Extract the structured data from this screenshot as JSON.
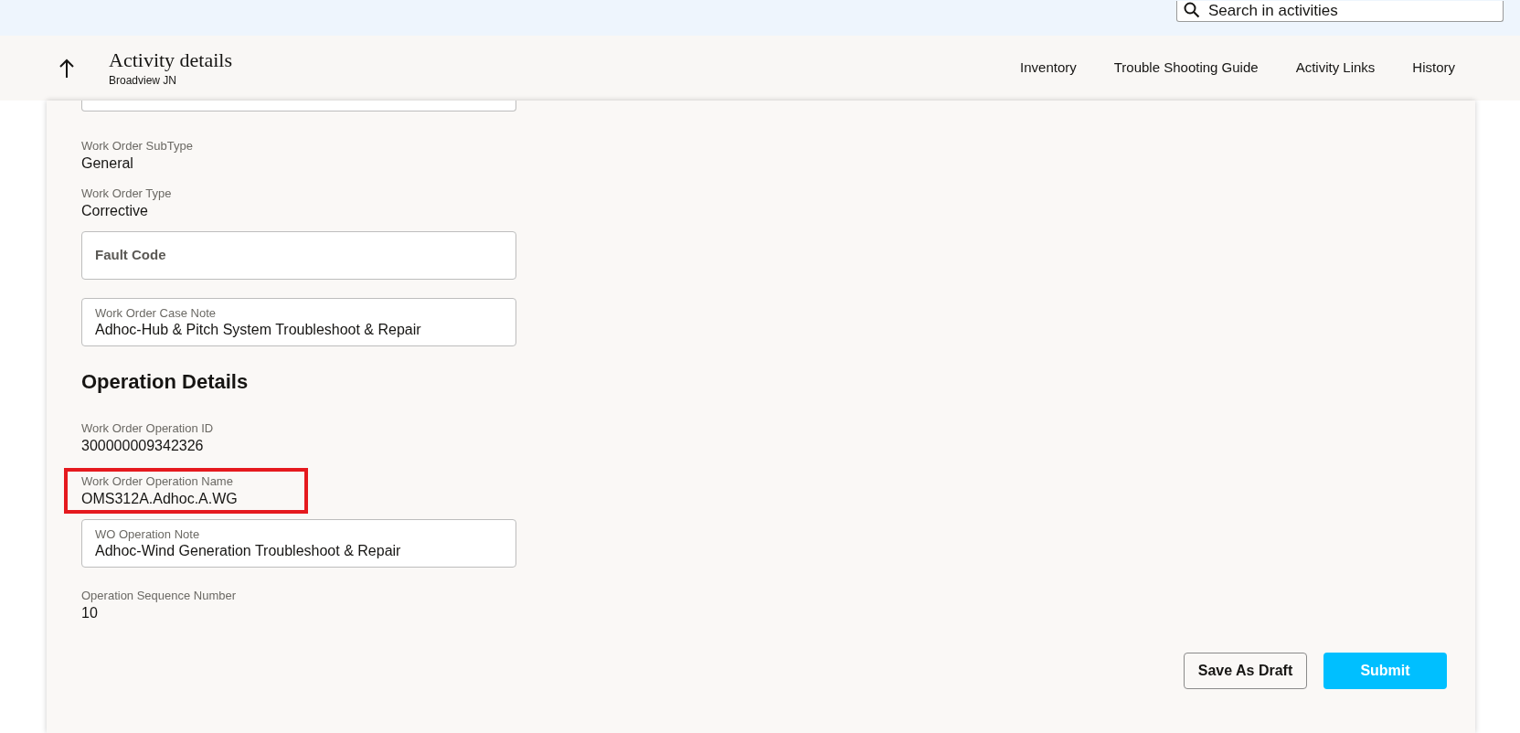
{
  "search": {
    "placeholder": "Search in activities"
  },
  "header": {
    "title": "Activity details",
    "subtitle": "Broadview JN"
  },
  "nav": [
    {
      "label": "Inventory"
    },
    {
      "label": "Trouble Shooting Guide"
    },
    {
      "label": "Activity Links"
    },
    {
      "label": "History"
    }
  ],
  "fields": [
    {
      "kind": "cutoff"
    },
    {
      "kind": "readonly",
      "label": "Work Order SubType",
      "value": "General",
      "highlighted": false
    },
    {
      "kind": "readonly",
      "label": "Work Order Type",
      "value": "Corrective",
      "highlighted": false
    },
    {
      "kind": "input",
      "placeholder": "Fault Code"
    },
    {
      "kind": "input",
      "label": "Work Order Case Note",
      "value": "Adhoc-Hub & Pitch System Troubleshoot & Repair"
    },
    {
      "kind": "heading",
      "text": "Operation Details"
    },
    {
      "kind": "readonly",
      "label": "Work Order Operation ID",
      "value": "300000009342326",
      "highlighted": false
    },
    {
      "kind": "readonly",
      "label": "Work Order Operation Name",
      "value": "OMS312A.Adhoc.A.WG",
      "highlighted": true
    },
    {
      "kind": "input",
      "label": "WO Operation Note",
      "value": "Adhoc-Wind Generation Troubleshoot & Repair"
    },
    {
      "kind": "readonly",
      "label": "Operation Sequence Number",
      "value": "10",
      "highlighted": false
    }
  ],
  "buttons": [
    {
      "label": "Save As Draft",
      "kind": "secondary"
    },
    {
      "label": "Submit",
      "kind": "primary"
    }
  ]
}
